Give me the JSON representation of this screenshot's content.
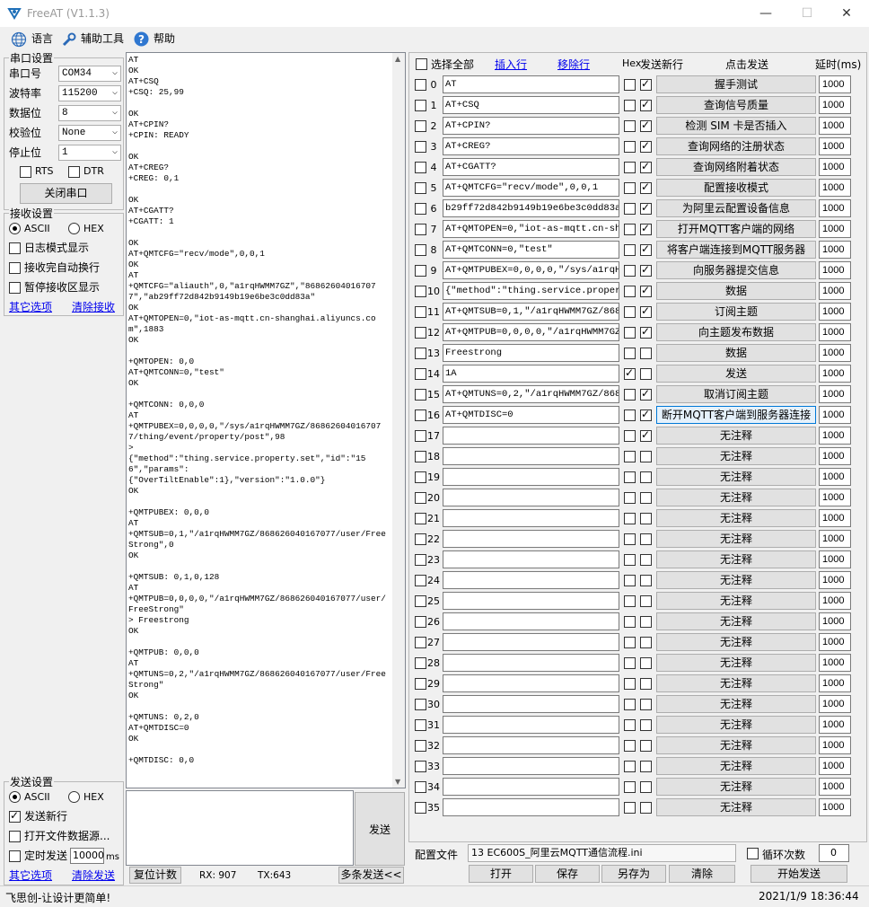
{
  "window": {
    "title": "FreeAT (V1.1.3)",
    "min": "—",
    "max": "☐",
    "close": "✕"
  },
  "menu": {
    "language": "语言",
    "tools": "辅助工具",
    "help": "帮助"
  },
  "serial": {
    "group": "串口设置",
    "port_label": "串口号",
    "port_value": "COM34",
    "baud_label": "波特率",
    "baud_value": "115200",
    "databits_label": "数据位",
    "databits_value": "8",
    "parity_label": "校验位",
    "parity_value": "None",
    "stopbits_label": "停止位",
    "stopbits_value": "1",
    "rts": "RTS",
    "dtr": "DTR",
    "close_btn": "关闭串口"
  },
  "receive": {
    "group": "接收设置",
    "ascii": "ASCII",
    "hex": "HEX",
    "log_mode": "日志模式显示",
    "auto_newline": "接收完自动换行",
    "pause": "暂停接收区显示",
    "other_options": "其它选项",
    "clear_recv": "清除接收"
  },
  "send": {
    "group": "发送设置",
    "ascii": "ASCII",
    "hex": "HEX",
    "newline": "发送新行",
    "open_file": "打开文件数据源...",
    "timed": "定时发送",
    "interval": "10000",
    "unit": "ms",
    "other_options": "其它选项",
    "clear_send": "清除发送",
    "send_btn": "发送"
  },
  "recv_log": "AT\nOK\nAT+CSQ\n+CSQ: 25,99\n\nOK\nAT+CPIN?\n+CPIN: READY\n\nOK\nAT+CREG?\n+CREG: 0,1\n\nOK\nAT+CGATT?\n+CGATT: 1\n\nOK\nAT+QMTCFG=\"recv/mode\",0,0,1\nOK\nAT\n+QMTCFG=\"aliauth\",0,\"a1rqHWMM7GZ\",\"868626040167077\",\"ab29ff72d842b9149b19e6be3c0dd83a\"\nOK\nAT+QMTOPEN=0,\"iot-as-mqtt.cn-shanghai.aliyuncs.com\",1883\nOK\n\n+QMTOPEN: 0,0\nAT+QMTCONN=0,\"test\"\nOK\n\n+QMTCONN: 0,0,0\nAT\n+QMTPUBEX=0,0,0,0,\"/sys/a1rqHWMM7GZ/868626040167077/thing/event/property/post\",98\n>\n{\"method\":\"thing.service.property.set\",\"id\":\"156\",\"params\":\n{\"OverTiltEnable\":1},\"version\":\"1.0.0\"}\nOK\n\n+QMTPUBEX: 0,0,0\nAT\n+QMTSUB=0,1,\"/a1rqHWMM7GZ/868626040167077/user/FreeStrong\",0\nOK\n\n+QMTSUB: 0,1,0,128\nAT\n+QMTPUB=0,0,0,0,\"/a1rqHWMM7GZ/868626040167077/user/FreeStrong\"\n> Freestrong\nOK\n\n+QMTPUB: 0,0,0\nAT\n+QMTUNS=0,2,\"/a1rqHWMM7GZ/868626040167077/user/FreeStrong\"\nOK\n\n+QMTUNS: 0,2,0\nAT+QMTDISC=0\nOK\n\n+QMTDISC: 0,0",
  "bottom": {
    "reset_count": "复位计数",
    "rx": "RX: 907",
    "tx": "TX:643",
    "multi_send": "多条发送<<"
  },
  "table": {
    "select_all": "选择全部",
    "insert_row": "插入行",
    "delete_row": "移除行",
    "hex": "Hex",
    "send_newline": "发送新行",
    "click_send": "点击发送",
    "delay": "延时(ms)",
    "rows": [
      {
        "n": "0",
        "cmd": "AT",
        "hex": false,
        "nl": true,
        "btn": "握手测试",
        "delay": "1000"
      },
      {
        "n": "1",
        "cmd": "AT+CSQ",
        "hex": false,
        "nl": true,
        "btn": "查询信号质量",
        "delay": "1000"
      },
      {
        "n": "2",
        "cmd": "AT+CPIN?",
        "hex": false,
        "nl": true,
        "btn": "检测 SIM 卡是否插入",
        "delay": "1000"
      },
      {
        "n": "3",
        "cmd": "AT+CREG?",
        "hex": false,
        "nl": true,
        "btn": "查询网络的注册状态",
        "delay": "1000"
      },
      {
        "n": "4",
        "cmd": "AT+CGATT?",
        "hex": false,
        "nl": true,
        "btn": "查询网络附着状态",
        "delay": "1000"
      },
      {
        "n": "5",
        "cmd": "AT+QMTCFG=\"recv/mode\",0,0,1",
        "hex": false,
        "nl": true,
        "btn": "配置接收模式",
        "delay": "1000"
      },
      {
        "n": "6",
        "cmd": "b29ff72d842b9149b19e6be3c0dd83a\"",
        "hex": false,
        "nl": true,
        "btn": "为阿里云配置设备信息",
        "delay": "1000"
      },
      {
        "n": "7",
        "cmd": "AT+QMTOPEN=0,\"iot-as-mqtt.cn-sha",
        "hex": false,
        "nl": true,
        "btn": "打开MQTT客户端的网络",
        "delay": "1000"
      },
      {
        "n": "8",
        "cmd": "AT+QMTCONN=0,\"test\"",
        "hex": false,
        "nl": true,
        "btn": "将客户端连接到MQTT服务器",
        "delay": "1000"
      },
      {
        "n": "9",
        "cmd": "AT+QMTPUBEX=0,0,0,0,\"/sys/a1rqHW",
        "hex": false,
        "nl": true,
        "btn": "向服务器提交信息",
        "delay": "1000"
      },
      {
        "n": "10",
        "cmd": "{\"method\":\"thing.service.propert",
        "hex": false,
        "nl": true,
        "btn": "数据",
        "delay": "1000"
      },
      {
        "n": "11",
        "cmd": "AT+QMTSUB=0,1,\"/a1rqHWMM7GZ/8686",
        "hex": false,
        "nl": true,
        "btn": "订阅主题",
        "delay": "1000"
      },
      {
        "n": "12",
        "cmd": "AT+QMTPUB=0,0,0,0,\"/a1rqHWMM7GZ/",
        "hex": false,
        "nl": true,
        "btn": "向主题发布数据",
        "delay": "1000"
      },
      {
        "n": "13",
        "cmd": "Freestrong",
        "hex": false,
        "nl": false,
        "btn": "数据",
        "delay": "1000"
      },
      {
        "n": "14",
        "cmd": "1A",
        "hex": true,
        "nl": false,
        "btn": "发送",
        "delay": "1000"
      },
      {
        "n": "15",
        "cmd": "AT+QMTUNS=0,2,\"/a1rqHWMM7GZ/8686",
        "hex": false,
        "nl": true,
        "btn": "取消订阅主题",
        "delay": "1000"
      },
      {
        "n": "16",
        "cmd": "AT+QMTDISC=0",
        "hex": false,
        "nl": true,
        "btn": "断开MQTT客户端到服务器连接",
        "delay": "1000"
      },
      {
        "n": "17",
        "cmd": "",
        "hex": false,
        "nl": true,
        "btn": "无注释",
        "delay": "1000"
      },
      {
        "n": "18",
        "cmd": "",
        "hex": false,
        "nl": false,
        "btn": "无注释",
        "delay": "1000"
      },
      {
        "n": "19",
        "cmd": "",
        "hex": false,
        "nl": false,
        "btn": "无注释",
        "delay": "1000"
      },
      {
        "n": "20",
        "cmd": "",
        "hex": false,
        "nl": false,
        "btn": "无注释",
        "delay": "1000"
      },
      {
        "n": "21",
        "cmd": "",
        "hex": false,
        "nl": false,
        "btn": "无注释",
        "delay": "1000"
      },
      {
        "n": "22",
        "cmd": "",
        "hex": false,
        "nl": false,
        "btn": "无注释",
        "delay": "1000"
      },
      {
        "n": "23",
        "cmd": "",
        "hex": false,
        "nl": false,
        "btn": "无注释",
        "delay": "1000"
      },
      {
        "n": "24",
        "cmd": "",
        "hex": false,
        "nl": false,
        "btn": "无注释",
        "delay": "1000"
      },
      {
        "n": "25",
        "cmd": "",
        "hex": false,
        "nl": false,
        "btn": "无注释",
        "delay": "1000"
      },
      {
        "n": "26",
        "cmd": "",
        "hex": false,
        "nl": false,
        "btn": "无注释",
        "delay": "1000"
      },
      {
        "n": "27",
        "cmd": "",
        "hex": false,
        "nl": false,
        "btn": "无注释",
        "delay": "1000"
      },
      {
        "n": "28",
        "cmd": "",
        "hex": false,
        "nl": false,
        "btn": "无注释",
        "delay": "1000"
      },
      {
        "n": "29",
        "cmd": "",
        "hex": false,
        "nl": false,
        "btn": "无注释",
        "delay": "1000"
      },
      {
        "n": "30",
        "cmd": "",
        "hex": false,
        "nl": false,
        "btn": "无注释",
        "delay": "1000"
      },
      {
        "n": "31",
        "cmd": "",
        "hex": false,
        "nl": false,
        "btn": "无注释",
        "delay": "1000"
      },
      {
        "n": "32",
        "cmd": "",
        "hex": false,
        "nl": false,
        "btn": "无注释",
        "delay": "1000"
      },
      {
        "n": "33",
        "cmd": "",
        "hex": false,
        "nl": false,
        "btn": "无注释",
        "delay": "1000"
      },
      {
        "n": "34",
        "cmd": "",
        "hex": false,
        "nl": false,
        "btn": "无注释",
        "delay": "1000"
      },
      {
        "n": "35",
        "cmd": "",
        "hex": false,
        "nl": false,
        "btn": "无注释",
        "delay": "1000"
      }
    ]
  },
  "config": {
    "file_label": "配置文件",
    "file_value": "13 EC600S_阿里云MQTT通信流程.ini",
    "loop_label": "循环次数",
    "loop_value": "0",
    "open": "打开",
    "save": "保存",
    "save_as": "另存为",
    "clear": "清除",
    "start_send": "开始发送"
  },
  "status": {
    "slogan": "飞思创-让设计更简单!",
    "datetime": "2021/1/9 18:36:44"
  },
  "colors": {
    "link": "#0000ee",
    "selected_border": "#0078d7"
  }
}
